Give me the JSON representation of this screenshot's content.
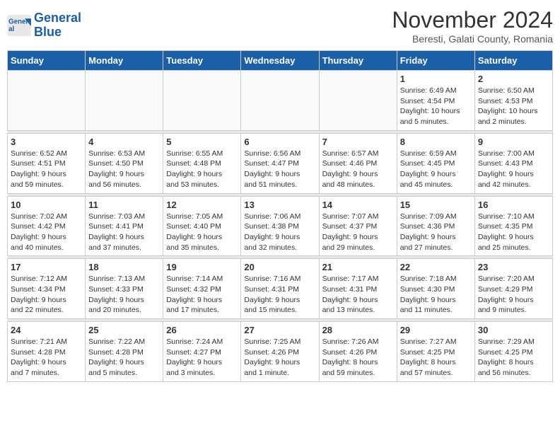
{
  "logo": {
    "line1": "General",
    "line2": "Blue"
  },
  "title": "November 2024",
  "location": "Beresti, Galati County, Romania",
  "weekdays": [
    "Sunday",
    "Monday",
    "Tuesday",
    "Wednesday",
    "Thursday",
    "Friday",
    "Saturday"
  ],
  "weeks": [
    [
      {
        "day": "",
        "info": ""
      },
      {
        "day": "",
        "info": ""
      },
      {
        "day": "",
        "info": ""
      },
      {
        "day": "",
        "info": ""
      },
      {
        "day": "",
        "info": ""
      },
      {
        "day": "1",
        "info": "Sunrise: 6:49 AM\nSunset: 4:54 PM\nDaylight: 10 hours\nand 5 minutes."
      },
      {
        "day": "2",
        "info": "Sunrise: 6:50 AM\nSunset: 4:53 PM\nDaylight: 10 hours\nand 2 minutes."
      }
    ],
    [
      {
        "day": "3",
        "info": "Sunrise: 6:52 AM\nSunset: 4:51 PM\nDaylight: 9 hours\nand 59 minutes."
      },
      {
        "day": "4",
        "info": "Sunrise: 6:53 AM\nSunset: 4:50 PM\nDaylight: 9 hours\nand 56 minutes."
      },
      {
        "day": "5",
        "info": "Sunrise: 6:55 AM\nSunset: 4:48 PM\nDaylight: 9 hours\nand 53 minutes."
      },
      {
        "day": "6",
        "info": "Sunrise: 6:56 AM\nSunset: 4:47 PM\nDaylight: 9 hours\nand 51 minutes."
      },
      {
        "day": "7",
        "info": "Sunrise: 6:57 AM\nSunset: 4:46 PM\nDaylight: 9 hours\nand 48 minutes."
      },
      {
        "day": "8",
        "info": "Sunrise: 6:59 AM\nSunset: 4:45 PM\nDaylight: 9 hours\nand 45 minutes."
      },
      {
        "day": "9",
        "info": "Sunrise: 7:00 AM\nSunset: 4:43 PM\nDaylight: 9 hours\nand 42 minutes."
      }
    ],
    [
      {
        "day": "10",
        "info": "Sunrise: 7:02 AM\nSunset: 4:42 PM\nDaylight: 9 hours\nand 40 minutes."
      },
      {
        "day": "11",
        "info": "Sunrise: 7:03 AM\nSunset: 4:41 PM\nDaylight: 9 hours\nand 37 minutes."
      },
      {
        "day": "12",
        "info": "Sunrise: 7:05 AM\nSunset: 4:40 PM\nDaylight: 9 hours\nand 35 minutes."
      },
      {
        "day": "13",
        "info": "Sunrise: 7:06 AM\nSunset: 4:38 PM\nDaylight: 9 hours\nand 32 minutes."
      },
      {
        "day": "14",
        "info": "Sunrise: 7:07 AM\nSunset: 4:37 PM\nDaylight: 9 hours\nand 29 minutes."
      },
      {
        "day": "15",
        "info": "Sunrise: 7:09 AM\nSunset: 4:36 PM\nDaylight: 9 hours\nand 27 minutes."
      },
      {
        "day": "16",
        "info": "Sunrise: 7:10 AM\nSunset: 4:35 PM\nDaylight: 9 hours\nand 25 minutes."
      }
    ],
    [
      {
        "day": "17",
        "info": "Sunrise: 7:12 AM\nSunset: 4:34 PM\nDaylight: 9 hours\nand 22 minutes."
      },
      {
        "day": "18",
        "info": "Sunrise: 7:13 AM\nSunset: 4:33 PM\nDaylight: 9 hours\nand 20 minutes."
      },
      {
        "day": "19",
        "info": "Sunrise: 7:14 AM\nSunset: 4:32 PM\nDaylight: 9 hours\nand 17 minutes."
      },
      {
        "day": "20",
        "info": "Sunrise: 7:16 AM\nSunset: 4:31 PM\nDaylight: 9 hours\nand 15 minutes."
      },
      {
        "day": "21",
        "info": "Sunrise: 7:17 AM\nSunset: 4:31 PM\nDaylight: 9 hours\nand 13 minutes."
      },
      {
        "day": "22",
        "info": "Sunrise: 7:18 AM\nSunset: 4:30 PM\nDaylight: 9 hours\nand 11 minutes."
      },
      {
        "day": "23",
        "info": "Sunrise: 7:20 AM\nSunset: 4:29 PM\nDaylight: 9 hours\nand 9 minutes."
      }
    ],
    [
      {
        "day": "24",
        "info": "Sunrise: 7:21 AM\nSunset: 4:28 PM\nDaylight: 9 hours\nand 7 minutes."
      },
      {
        "day": "25",
        "info": "Sunrise: 7:22 AM\nSunset: 4:28 PM\nDaylight: 9 hours\nand 5 minutes."
      },
      {
        "day": "26",
        "info": "Sunrise: 7:24 AM\nSunset: 4:27 PM\nDaylight: 9 hours\nand 3 minutes."
      },
      {
        "day": "27",
        "info": "Sunrise: 7:25 AM\nSunset: 4:26 PM\nDaylight: 9 hours\nand 1 minute."
      },
      {
        "day": "28",
        "info": "Sunrise: 7:26 AM\nSunset: 4:26 PM\nDaylight: 8 hours\nand 59 minutes."
      },
      {
        "day": "29",
        "info": "Sunrise: 7:27 AM\nSunset: 4:25 PM\nDaylight: 8 hours\nand 57 minutes."
      },
      {
        "day": "30",
        "info": "Sunrise: 7:29 AM\nSunset: 4:25 PM\nDaylight: 8 hours\nand 56 minutes."
      }
    ]
  ]
}
